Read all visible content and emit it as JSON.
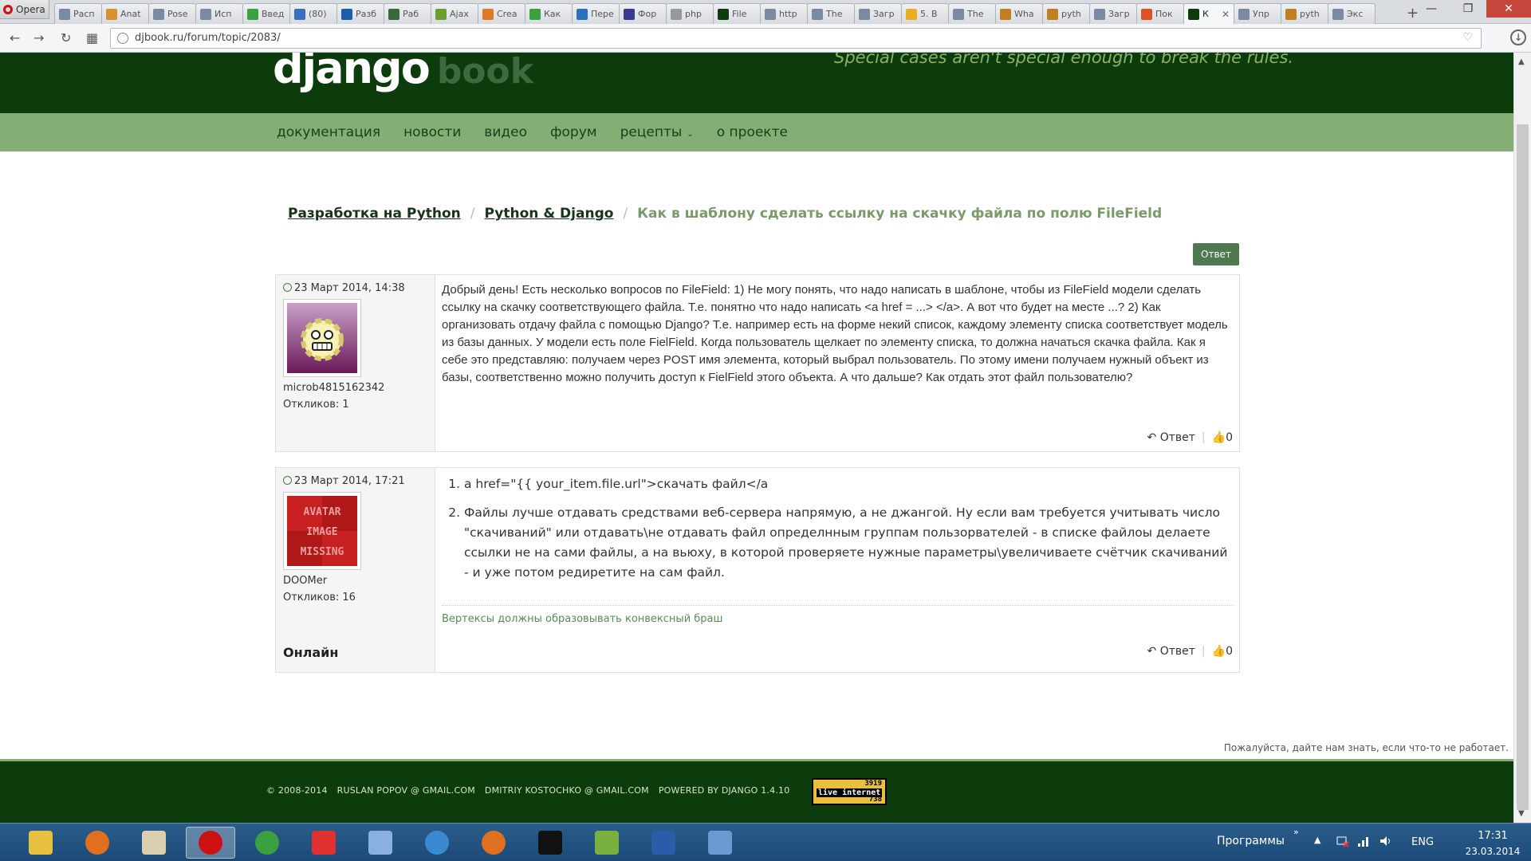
{
  "browser": {
    "menu_label": "Opera",
    "tabs": [
      {
        "label": "Расп",
        "color": "#7a8aa0"
      },
      {
        "label": "Anat",
        "color": "#d89030"
      },
      {
        "label": "Pose",
        "color": "#7a8aa0"
      },
      {
        "label": "Исп",
        "color": "#7a8aa0"
      },
      {
        "label": "Введ",
        "color": "#3aa040"
      },
      {
        "label": "(80)",
        "color": "#3a6ec0"
      },
      {
        "label": "Разб",
        "color": "#1b5da8"
      },
      {
        "label": "Раб",
        "color": "#3a6a3a"
      },
      {
        "label": "Ajax",
        "color": "#6aa030"
      },
      {
        "label": "Crea",
        "color": "#e07a20"
      },
      {
        "label": "Как",
        "color": "#3aa040"
      },
      {
        "label": "Пере",
        "color": "#2a70c0"
      },
      {
        "label": "Фор",
        "color": "#3a3a90"
      },
      {
        "label": "php",
        "color": "#999999"
      },
      {
        "label": "File",
        "color": "#0c3c0c"
      },
      {
        "label": "http",
        "color": "#7a8aa0"
      },
      {
        "label": "The",
        "color": "#7a8aa0"
      },
      {
        "label": "Загр",
        "color": "#7a8aa0"
      },
      {
        "label": "5. В",
        "color": "#e8b020"
      },
      {
        "label": "The",
        "color": "#7a8aa0"
      },
      {
        "label": "Wha",
        "color": "#c08020"
      },
      {
        "label": "pyth",
        "color": "#c08020"
      },
      {
        "label": "Загр",
        "color": "#7a8aa0"
      },
      {
        "label": "Пок",
        "color": "#e05020"
      },
      {
        "label": "К",
        "color": "#0c3c0c",
        "active": true
      },
      {
        "label": "Упр",
        "color": "#7a8aa0"
      },
      {
        "label": "pyth",
        "color": "#c08020"
      },
      {
        "label": "Экс",
        "color": "#7a8aa0"
      }
    ],
    "new_tab": "+",
    "window_controls": {
      "minimize": "—",
      "maximize": "❐",
      "close": "✕"
    },
    "url": "djbook.ru/forum/topic/2083/",
    "nav": {
      "back": "←",
      "forward": "→",
      "reload": "↻",
      "grid": "▦"
    }
  },
  "site": {
    "logo": "django",
    "logo_suffix": "book",
    "tagline": "Special cases aren't special enough to break the rules.",
    "nav": [
      {
        "label": "документация"
      },
      {
        "label": "новости"
      },
      {
        "label": "видео"
      },
      {
        "label": "форум"
      },
      {
        "label": "рецепты",
        "caret": true
      },
      {
        "label": "о проекте"
      }
    ]
  },
  "breadcrumb": {
    "items": [
      "Разработка на Python",
      "Python & Django"
    ],
    "current": "Как в шаблону сделать ссылку на скачку файла по полю FileField"
  },
  "reply_button": "Ответ",
  "posts": [
    {
      "date": "23 Март 2014, 14:38",
      "username": "microb4815162342",
      "replies": "Откликов: 1",
      "text": "Добрый день! Есть несколько вопросов по FileField: 1) Не могу понять, что надо написать в шаблоне, чтобы из FileField модели сделать ссылку на скачку соответствующего файла. Т.е. понятно что надо написать <a href = ...> </a>. А вот что будет на месте ...? 2) Как организовать отдачу файла с помощью Django? Т.е. например есть на форме некий список, каждому элементу списка соответствует модель из базы данных. У модели есть поле FielField. Когда пользователь щелкает по элементу списка, то должна начаться скачка файла. Как я себе это представляю: получаем через POST имя элемента, который выбрал пользователь. По этому имени получаем нужный объект из базы, соответственно можно получить доступ к FielField этого объекта. А что дальше? Как отдать этот файл пользователю?",
      "reply": "Ответ",
      "likes": "0"
    },
    {
      "date": "23 Март 2014, 17:21",
      "username": "DOOMer",
      "replies": "Откликов: 16",
      "avatar_text": [
        "AVATAR",
        "IMAGE",
        "MISSING"
      ],
      "items": [
        "a href=\"{{ your_item.file.url\">скачать файл</a",
        "Файлы лучше отдавать средствами веб-сервера напрямую, а не джангой. Ну если вам требуется учитывать число \"скачиваний\" или отдавать\\не отдавать файл определнным группам пользорвателей - в списке файлоы делаете ссылки не на сами файлы, а на вьюху, в которой проверяете нужные параметры\\увеличиваете счётчик скачиваний - и уже потом редиретите на сам файл."
      ],
      "signature": "Вертексы должны образовывать конвексный браш",
      "online": "Онлайн",
      "reply": "Ответ",
      "likes": "0"
    }
  ],
  "feedback": "Пожалуйста, дайте нам знать, если что-то не работает.",
  "footer": {
    "items": [
      "© 2008-2014",
      "RUSLAN POPOV @ GMAIL.COM",
      "DMITRIY KOSTOCHKO @ GMAIL.COM",
      "POWERED BY DJANGO 1.4.10"
    ],
    "counter": {
      "top": "3919",
      "mid": "live internet",
      "bottom": "738"
    }
  },
  "taskbar": {
    "apps": [
      {
        "name": "explorer",
        "color": "#e8c040"
      },
      {
        "name": "chrome-canary",
        "color": "#e07020"
      },
      {
        "name": "notepad",
        "color": "#d8d0b0"
      },
      {
        "name": "opera",
        "color": "#cc1111",
        "active": true
      },
      {
        "name": "chrome",
        "color": "#3aa040"
      },
      {
        "name": "yandex-browser",
        "color": "#e03030"
      },
      {
        "name": "speaker",
        "color": "#8ab0e0"
      },
      {
        "name": "internet-explorer",
        "color": "#3a8ad0"
      },
      {
        "name": "firefox",
        "color": "#e07020"
      },
      {
        "name": "cmd",
        "color": "#111111"
      },
      {
        "name": "greenshot",
        "color": "#7ab040"
      },
      {
        "name": "word",
        "color": "#2a5caa"
      },
      {
        "name": "picture-viewer",
        "color": "#6a9ad0"
      }
    ],
    "programs_label": "Программы",
    "lang": "ENG",
    "time": "17:31",
    "date": "23.03.2014"
  }
}
